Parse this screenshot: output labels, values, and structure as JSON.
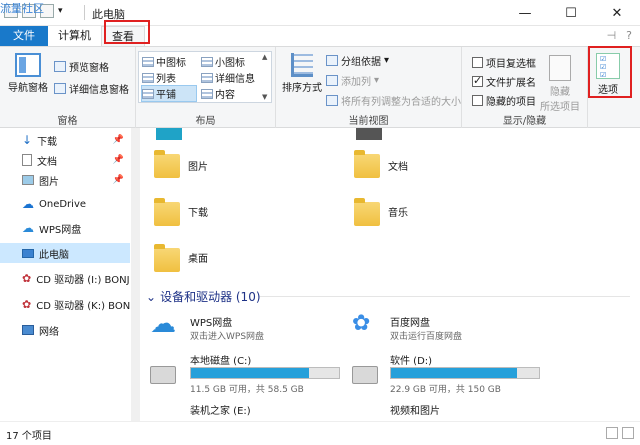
{
  "window": {
    "watermark": "流量社区",
    "title": "此电脑",
    "minimize": "—",
    "maximize": "☐",
    "close": "✕"
  },
  "tabs": {
    "file": "文件",
    "computer": "计算机",
    "view": "查看",
    "pin_symbol": "⊣",
    "help_symbol": "?"
  },
  "ribbon": {
    "panes": {
      "nav_pane": "导航窗格",
      "preview_pane": "预览窗格",
      "details_pane": "详细信息窗格",
      "label": "窗格"
    },
    "layout": {
      "medium_icons": "中图标",
      "small_icons": "小图标",
      "list": "列表",
      "details": "详细信息",
      "tiles": "平铺",
      "content": "内容",
      "label": "布局"
    },
    "current_view": {
      "sort_by": "排序方式",
      "group_by": "分组依据",
      "add_column": "添加列",
      "size_all_columns": "将所有列调整为合适的大小",
      "label": "当前视图"
    },
    "show_hide": {
      "item_checkboxes": "项目复选框",
      "item_checkboxes_checked": false,
      "file_extensions": "文件扩展名",
      "file_extensions_checked": true,
      "hidden_items": "隐藏的项目",
      "hidden_items_checked": false,
      "hide_selected": "隐藏",
      "hide_selected_sub": "所选项目",
      "label": "显示/隐藏"
    },
    "options": "选项"
  },
  "sidebar": {
    "items": [
      {
        "label": "下载",
        "pinned": true
      },
      {
        "label": "文档",
        "pinned": true
      },
      {
        "label": "图片",
        "pinned": true
      },
      {
        "label": "OneDrive"
      },
      {
        "label": "WPS网盘"
      },
      {
        "label": "此电脑"
      },
      {
        "label": "CD 驱动器 (I:) BONJ"
      },
      {
        "label": "CD 驱动器 (K:) BON"
      },
      {
        "label": "网络"
      }
    ]
  },
  "content": {
    "folders": [
      {
        "label": "图片"
      },
      {
        "label": "文档"
      },
      {
        "label": "下载"
      },
      {
        "label": "音乐"
      },
      {
        "label": "桌面"
      }
    ],
    "devices_header": "设备和驱动器 (10)",
    "devices": [
      {
        "name": "WPS网盘",
        "sub": "双击进入WPS网盘"
      },
      {
        "name": "百度网盘",
        "sub": "双击运行百度网盘"
      },
      {
        "name": "本地磁盘 (C:)",
        "sub": "11.5 GB 可用，共 58.5 GB",
        "used": 0.8
      },
      {
        "name": "软件 (D:)",
        "sub": "22.9 GB 可用，共 150 GB",
        "used": 0.85
      },
      {
        "name": "装机之家 (E:)"
      },
      {
        "name": "视频和图片"
      }
    ]
  },
  "status": {
    "count": "17 个项目"
  },
  "colors": {
    "accent": "#1979ca",
    "highlight_box": "#e02020",
    "selection": "#cce8ff",
    "drive_bar": "#26a0da"
  }
}
